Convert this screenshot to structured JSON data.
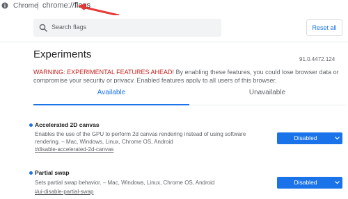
{
  "address_bar": {
    "browser_label": "Chrome",
    "url_scheme": "chrome://",
    "url_host": "flags"
  },
  "header": {
    "search_placeholder": "Search flags",
    "reset_label": "Reset all"
  },
  "main": {
    "title": "Experiments",
    "version": "91.0.4472.124",
    "warning_strong": "WARNING: EXPERIMENTAL FEATURES AHEAD!",
    "warning_text": " By enabling these features, you could lose browser data or compromise your security or privacy. Enabled features apply to all users of this browser.",
    "tabs": [
      {
        "label": "Available",
        "active": true
      },
      {
        "label": "Unavailable",
        "active": false
      }
    ],
    "flags": [
      {
        "name": "Accelerated 2D canvas",
        "description": "Enables the use of the GPU to perform 2d canvas rendering instead of using software rendering. – Mac, Windows, Linux, Chrome OS, Android",
        "link": "#disable-accelerated-2d-canvas",
        "value": "Disabled"
      },
      {
        "name": "Partial swap",
        "description": "Sets partial swap behavior. – Mac, Windows, Linux, Chrome OS, Android",
        "link": "#ui-disable-partial-swap",
        "value": "Disabled"
      }
    ]
  },
  "colors": {
    "accent": "#1a73e8",
    "warning": "#c5221f",
    "annotation_arrow": "#e53935"
  }
}
